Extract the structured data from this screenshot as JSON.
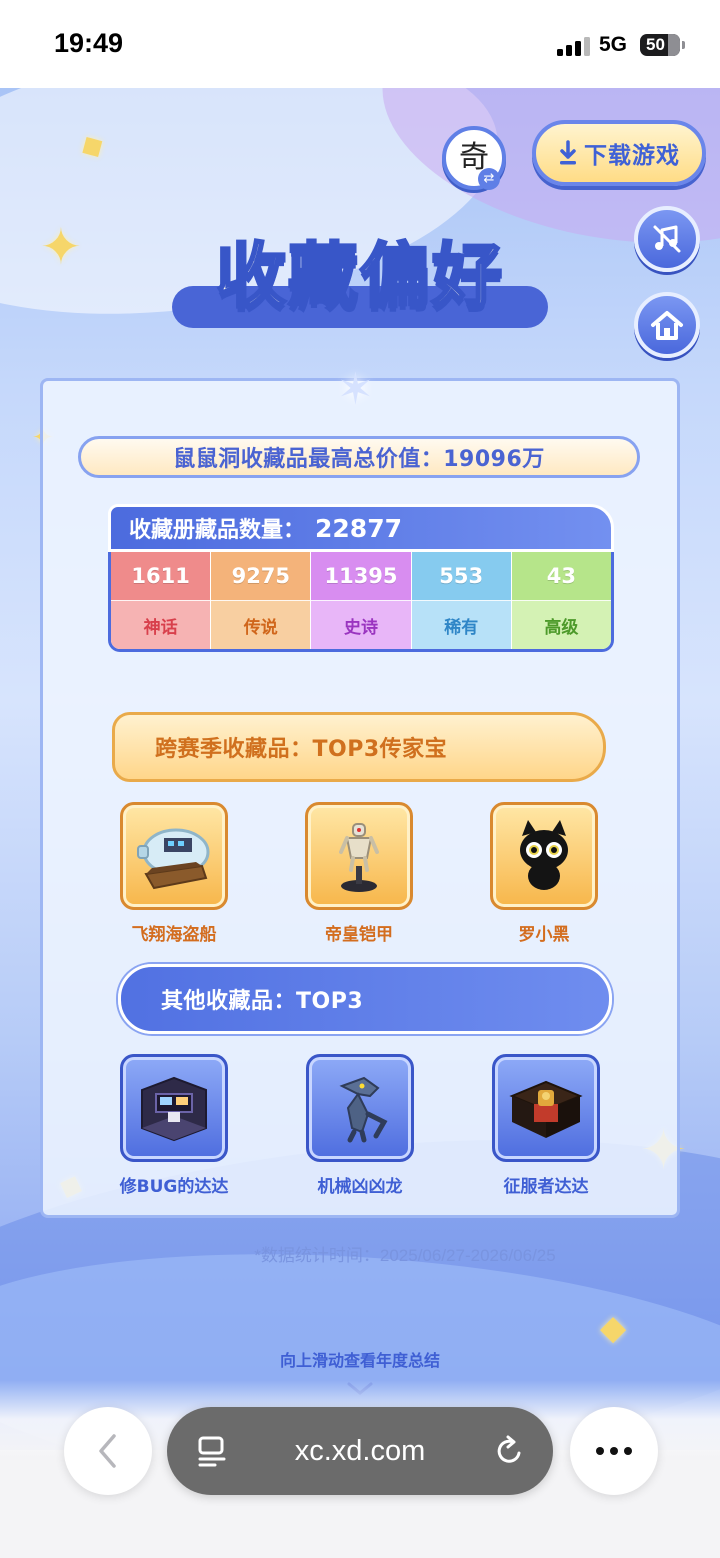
{
  "status_bar": {
    "time": "19:49",
    "network": "5G",
    "battery": "50"
  },
  "header": {
    "logo_text": "奇",
    "download_label": "下载游戏",
    "music_icon": "music-off-icon",
    "home_icon": "home-icon"
  },
  "page": {
    "title": "收藏偏好",
    "total_value_label": "鼠鼠洞收藏品最高总价值：",
    "total_value": "19096万",
    "album_label": "收藏册藏品数量：",
    "album_count": "22877"
  },
  "rarities": [
    {
      "count": "1611",
      "name": "神话",
      "top": "#ef8b8b",
      "bottom": "#f6b3b3",
      "text": "#d8404c"
    },
    {
      "count": "9275",
      "name": "传说",
      "top": "#f4b37a",
      "bottom": "#f8cfa1",
      "text": "#d0661b"
    },
    {
      "count": "11395",
      "name": "史诗",
      "top": "#d88df0",
      "bottom": "#e8b6f8",
      "text": "#9a35c0"
    },
    {
      "count": "553",
      "name": "稀有",
      "top": "#86cbef",
      "bottom": "#b7e1f8",
      "text": "#2f86c7"
    },
    {
      "count": "43",
      "name": "高级",
      "top": "#b6e58a",
      "bottom": "#d4f2b4",
      "text": "#4d9a2a"
    }
  ],
  "cross_season": {
    "title": "跨赛季收藏品：TOP3传家宝",
    "items": [
      {
        "name": "飞翔海盗船",
        "icon": "pirate-ship-bottle-icon"
      },
      {
        "name": "帝皇铠甲",
        "icon": "emperor-armor-statue-icon"
      },
      {
        "name": "罗小黑",
        "icon": "black-cat-plush-icon"
      }
    ]
  },
  "other": {
    "title": "其他收藏品：TOP3",
    "items": [
      {
        "name": "修BUG的达达",
        "icon": "debug-room-icon"
      },
      {
        "name": "机械凶凶龙",
        "icon": "mecha-dragon-icon"
      },
      {
        "name": "征服者达达",
        "icon": "conqueror-throne-icon"
      }
    ]
  },
  "footer": {
    "stat_period": "*数据统计时间：2025/06/27-2026/06/25",
    "scroll_hint": "向上滑动查看年度总结"
  },
  "browser": {
    "url": "xc.xd.com"
  },
  "colors": {
    "accent_blue": "#4a68dc",
    "gold": "#f7b64a",
    "title_cream": "#fff9e9"
  }
}
